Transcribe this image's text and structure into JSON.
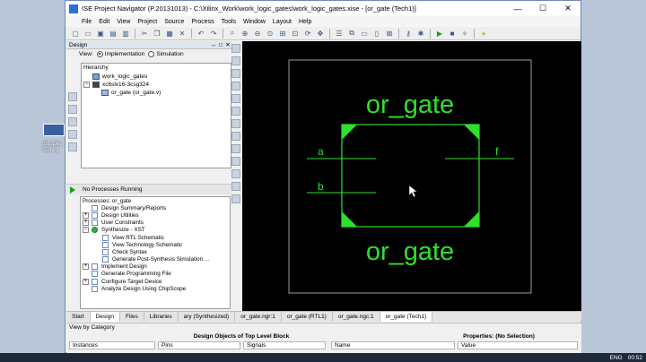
{
  "window": {
    "title": "ISE Project Navigator (P.20131013) - C:\\Xilinx_Work\\work_logic_gates\\work_logic_gates.xise - [or_gate (Tech1)]",
    "controls": {
      "minimize": "—",
      "maximize": "☐",
      "close": "✕"
    }
  },
  "menu": [
    "File",
    "Edit",
    "View",
    "Project",
    "Source",
    "Process",
    "Tools",
    "Window",
    "Layout",
    "Help"
  ],
  "design_pane": {
    "header": "Design",
    "view_label": "View:",
    "view_options": [
      "Implementation",
      "Simulation"
    ],
    "hierarchy_label": "Hierarchy",
    "tree": [
      {
        "label": "work_logic_gates",
        "level": 0,
        "icon": "project-icon"
      },
      {
        "label": "xc6slx16-3csg324",
        "level": 0,
        "icon": "chip-icon",
        "toggle": "−"
      },
      {
        "label": "or_gate (or_gate.v)",
        "level": 1,
        "icon": "verilog-file-icon"
      }
    ]
  },
  "process_pane": {
    "status": "No Processes Running",
    "header": "Processes: or_gate",
    "items": [
      {
        "label": "Design Summary/Reports",
        "level": 0,
        "toggle": "",
        "icon": "doc"
      },
      {
        "label": "Design Utilities",
        "level": 0,
        "toggle": "+",
        "icon": "doc"
      },
      {
        "label": "User Constraints",
        "level": 0,
        "toggle": "+",
        "icon": "doc"
      },
      {
        "label": "Synthesize - XST",
        "level": 0,
        "toggle": "−",
        "icon": "ok"
      },
      {
        "label": "View RTL Schematic",
        "level": 1,
        "toggle": "",
        "icon": "doc"
      },
      {
        "label": "View Technology Schematic",
        "level": 1,
        "toggle": "",
        "icon": "doc"
      },
      {
        "label": "Check Syntax",
        "level": 1,
        "toggle": "",
        "icon": "doc"
      },
      {
        "label": "Generate Post-Synthesis Simulation ...",
        "level": 1,
        "toggle": "",
        "icon": "doc"
      },
      {
        "label": "Implement Design",
        "level": 0,
        "toggle": "+",
        "icon": "doc"
      },
      {
        "label": "Generate Programming File",
        "level": 0,
        "toggle": "",
        "icon": "doc"
      },
      {
        "label": "Configure Target Device",
        "level": 0,
        "toggle": "+",
        "icon": "doc"
      },
      {
        "label": "Analyze Design Using ChipScope",
        "level": 0,
        "toggle": "",
        "icon": "doc"
      }
    ]
  },
  "schematic": {
    "instance_top": "or_gate",
    "instance_bottom": "or_gate",
    "input_a": "a",
    "input_b": "b",
    "output_f": "f",
    "colors": {
      "background": "#000000",
      "wire": "#2ee02e",
      "border": "#9a9a9a"
    }
  },
  "bottom_tabs": [
    "Start",
    "Design",
    "Files",
    "Libraries"
  ],
  "editor_tabs": [
    "ary (Synthesized)",
    "or_gate.ngr:1",
    "or_gate (RTL1)",
    "or_gate.ngc:1",
    "or_gate (Tech1)"
  ],
  "lower_panel": {
    "view_by": "View by Category",
    "objects_title": "Design Objects of Top Level Block",
    "properties_title": "Properties: (No Selection)",
    "columns": [
      "Instances",
      "Pins",
      "Signals",
      "Name",
      "Value"
    ]
  },
  "taskbar": {
    "lang": "ENG",
    "time": "00:52"
  }
}
